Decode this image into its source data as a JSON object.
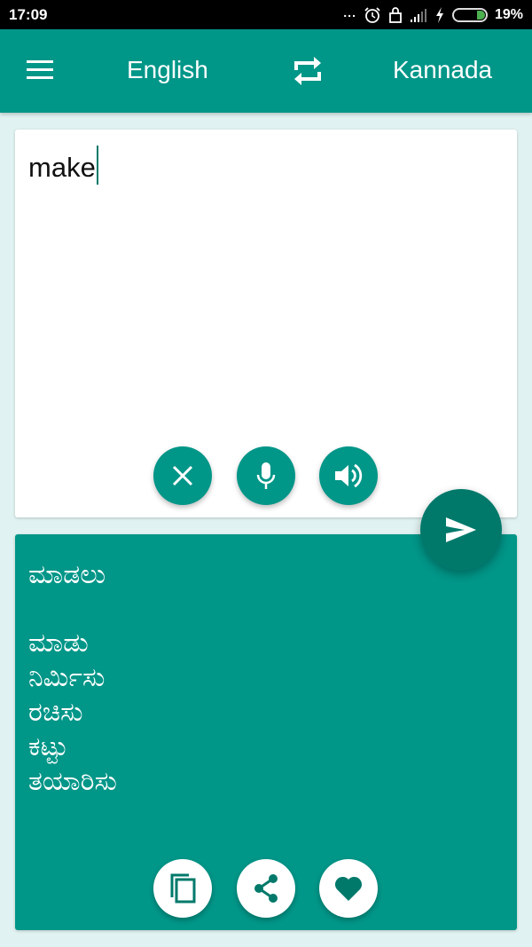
{
  "status_bar": {
    "time": "17:09",
    "more_indicator": "...",
    "icons": [
      "alarm-icon",
      "lock-icon",
      "signal-icon",
      "charging-icon",
      "battery-icon"
    ],
    "battery_percent": "19%",
    "battery_level": 0.19
  },
  "app_bar": {
    "menu_icon": "hamburger-menu-icon",
    "source_language": "English",
    "swap_icon": "swap-languages-icon",
    "target_language": "Kannada",
    "color": "#009688"
  },
  "input": {
    "value": "make",
    "actions": [
      {
        "icon": "clear-icon",
        "label": "Clear"
      },
      {
        "icon": "microphone-icon",
        "label": "Voice input"
      },
      {
        "icon": "speaker-icon",
        "label": "Speak"
      }
    ]
  },
  "translate_fab": {
    "icon": "send-icon",
    "color": "#00796b"
  },
  "output": {
    "main_translation": "ಮಾಡಲು",
    "alternatives": [
      "ಮಾಡು",
      "ನಿರ್ಮಿಸು",
      "ರಚಿಸು",
      "ಕಟ್ಟು",
      "ತಯಾರಿಸು"
    ],
    "actions": [
      {
        "icon": "copy-icon",
        "label": "Copy"
      },
      {
        "icon": "share-icon",
        "label": "Share"
      },
      {
        "icon": "heart-icon",
        "label": "Favorite"
      }
    ]
  },
  "colors": {
    "primary": "#009688",
    "primary_dark": "#00796b",
    "background": "#e0f2f1"
  }
}
